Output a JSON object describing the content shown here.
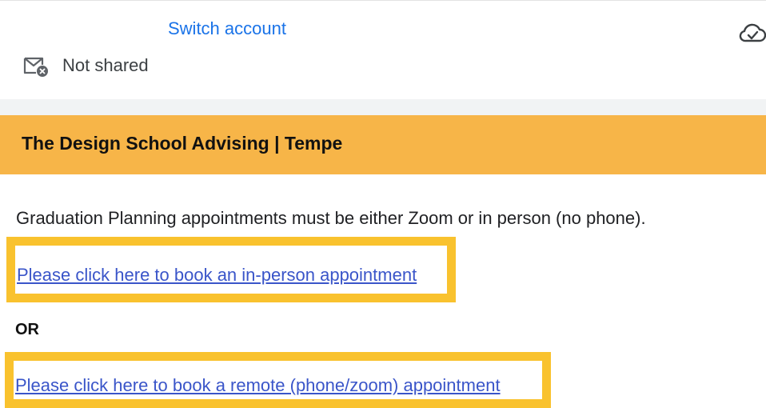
{
  "account": {
    "switch_label": "Switch account",
    "share_status": "Not shared"
  },
  "icons": {
    "mail": "mail-blocked-icon",
    "cloud": "cloud-done-icon"
  },
  "banner": {
    "title": "The Design School Advising | Tempe",
    "color": "#f7b548"
  },
  "content": {
    "description": "Graduation Planning appointments must be either Zoom or in person (no phone).",
    "link_in_person": "Please click here to book an in-person appointment",
    "or_label": "OR",
    "link_remote": "Please click here to book a remote (phone/zoom) appointment"
  },
  "colors": {
    "link": "#3a55c9",
    "highlight": "#f9c22e",
    "accent_blue": "#1a73e8"
  }
}
